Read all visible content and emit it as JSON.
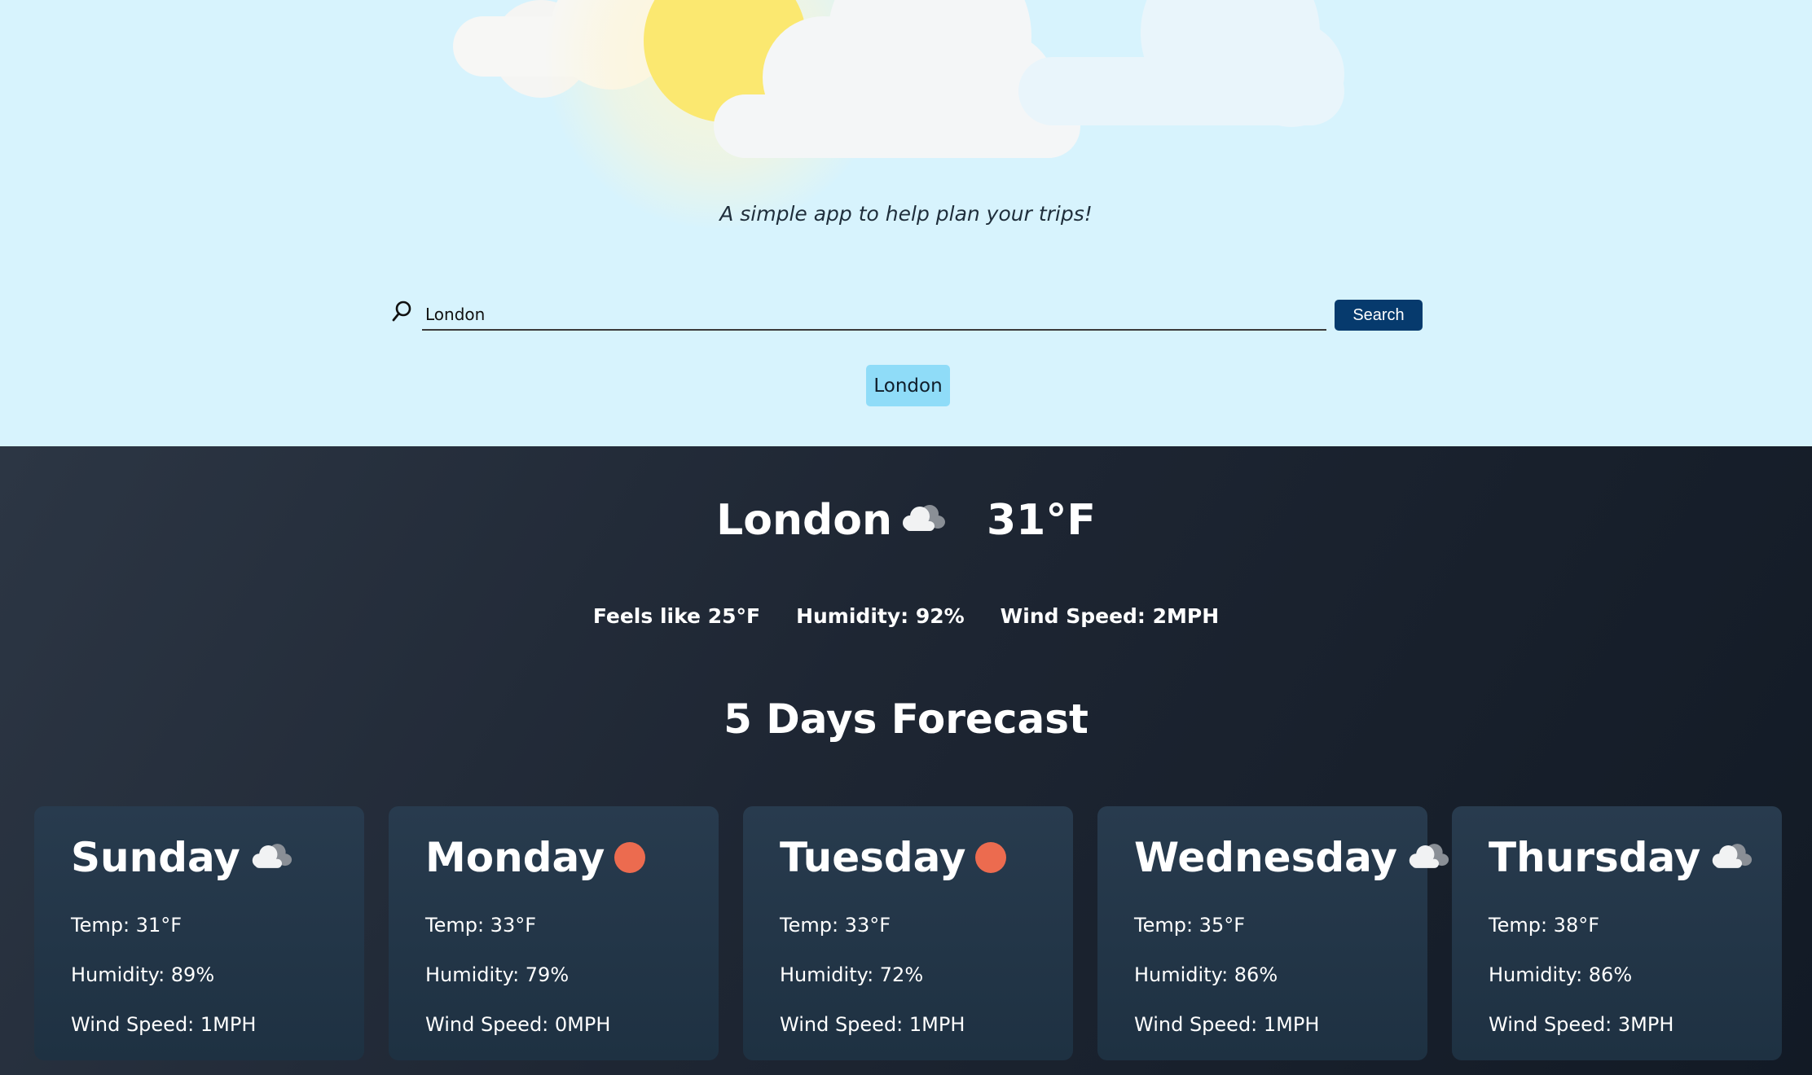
{
  "hero": {
    "tagline": "A simple app to help plan your trips!"
  },
  "search": {
    "value": "London",
    "button_label": "Search",
    "suggestion": "London"
  },
  "current": {
    "city": "London",
    "icon": "cloudy-icon",
    "temp": "31°F",
    "feels_like": "Feels like 25°F",
    "humidity": "Humidity: 92%",
    "wind": "Wind Speed: 2MPH"
  },
  "forecast": {
    "title": "5 Days Forecast",
    "days": [
      {
        "day": "Sunday",
        "icon": "cloudy-icon",
        "temp": "Temp: 31°F",
        "humidity": "Humidity: 89%",
        "wind": "Wind Speed: 1MPH"
      },
      {
        "day": "Monday",
        "icon": "sun-icon",
        "temp": "Temp: 33°F",
        "humidity": "Humidity: 79%",
        "wind": "Wind Speed: 0MPH"
      },
      {
        "day": "Tuesday",
        "icon": "sun-icon",
        "temp": "Temp: 33°F",
        "humidity": "Humidity: 72%",
        "wind": "Wind Speed: 1MPH"
      },
      {
        "day": "Wednesday",
        "icon": "cloudy-icon",
        "temp": "Temp: 35°F",
        "humidity": "Humidity: 86%",
        "wind": "Wind Speed: 1MPH"
      },
      {
        "day": "Thursday",
        "icon": "cloudy-icon",
        "temp": "Temp: 38°F",
        "humidity": "Humidity: 86%",
        "wind": "Wind Speed: 3MPH"
      }
    ]
  },
  "colors": {
    "hero_bg": "#d7f3fd",
    "search_button": "#063a6d",
    "suggestion_bg": "#8fdcf8",
    "sun_icon": "#ec6b4f"
  }
}
